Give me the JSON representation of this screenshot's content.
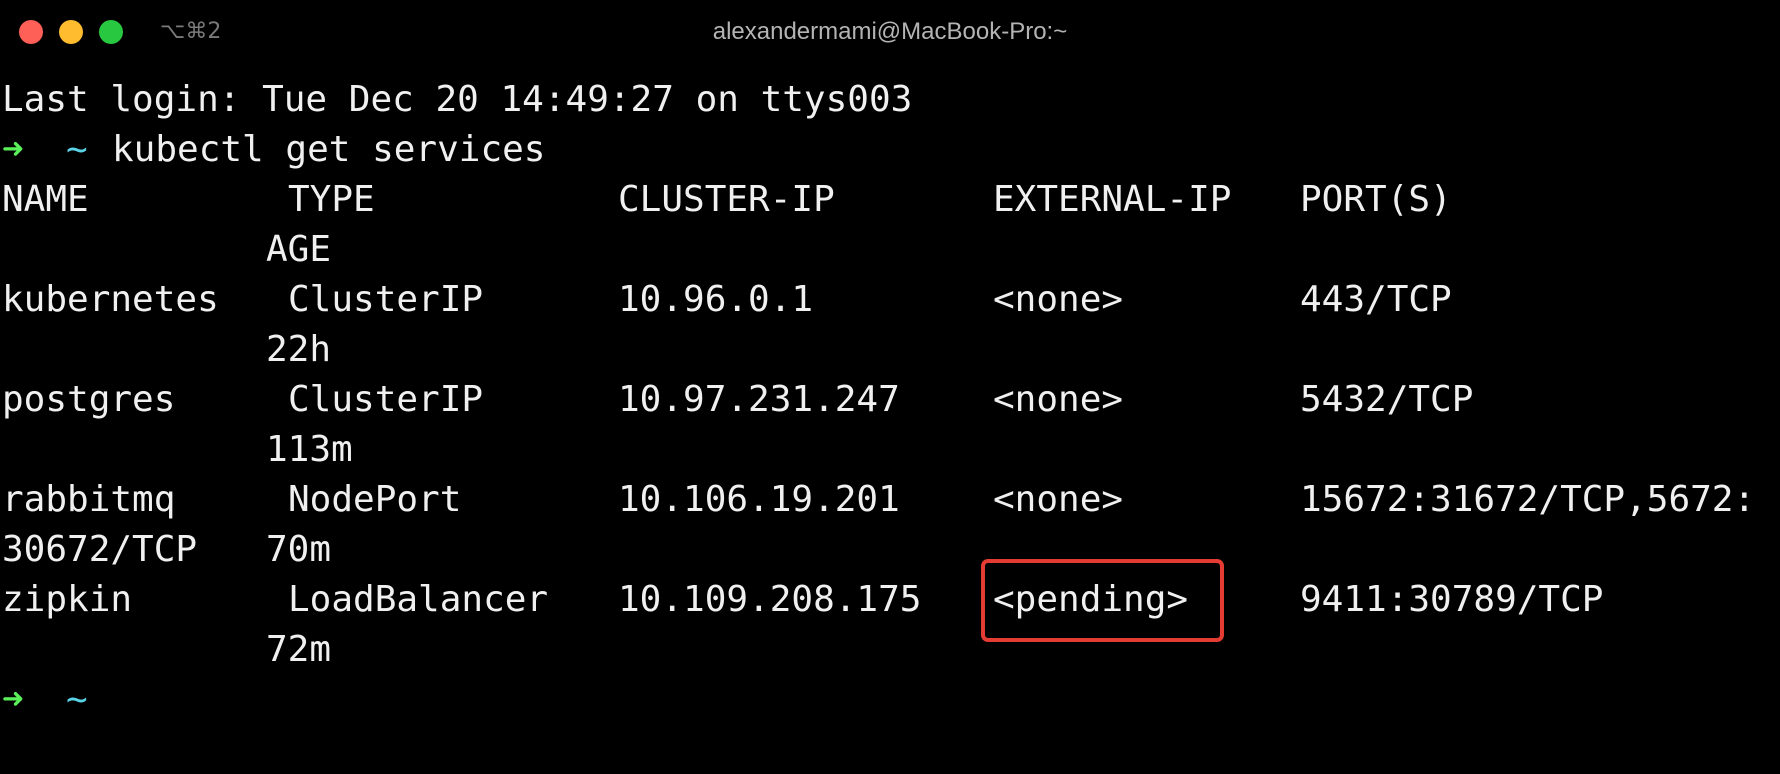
{
  "window": {
    "title": "alexandermami@MacBook-Pro:~",
    "shortcut": "⌥⌘2"
  },
  "terminal": {
    "last_login": "Last login: Tue Dec 20 14:49:27 on ttys003",
    "prompt": {
      "arrow": "➜",
      "cwd": "~"
    },
    "command": "kubectl get services",
    "columns": {
      "name": "NAME",
      "type": "TYPE",
      "cluster_ip": "CLUSTER-IP",
      "external_ip": "EXTERNAL-IP",
      "ports": "PORT(S)",
      "age": "AGE"
    },
    "services": [
      {
        "name": "kubernetes",
        "type": "ClusterIP",
        "cluster_ip": "10.96.0.1",
        "external_ip": "<none>",
        "ports": "443/TCP",
        "ports_wrap": "",
        "age": "22h"
      },
      {
        "name": "postgres",
        "type": "ClusterIP",
        "cluster_ip": "10.97.231.247",
        "external_ip": "<none>",
        "ports": "5432/TCP",
        "ports_wrap": "",
        "age": "113m"
      },
      {
        "name": "rabbitmq",
        "type": "NodePort",
        "cluster_ip": "10.106.19.201",
        "external_ip": "<none>",
        "ports": "15672:31672/TCP,5672:",
        "ports_wrap": "30672/TCP",
        "age": "70m"
      },
      {
        "name": "zipkin",
        "type": "LoadBalancer",
        "cluster_ip": "10.109.208.175",
        "external_ip": "<pending>",
        "ports": "9411:30789/TCP",
        "ports_wrap": "",
        "age": "72m"
      }
    ],
    "highlighted_cell": "zipkin external-ip",
    "colors": {
      "background": "#000000",
      "text": "#f0f0f0",
      "prompt_arrow": "#5af05a",
      "prompt_cwd": "#5ad3e6",
      "highlight_border": "#e43b33"
    }
  }
}
